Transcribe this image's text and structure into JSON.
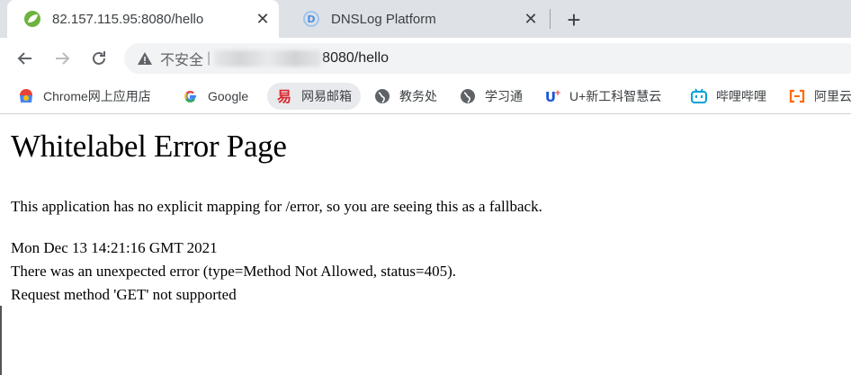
{
  "tabs": [
    {
      "title": "82.157.115.95:8080/hello",
      "icon": "spring-leaf-icon",
      "active": true
    },
    {
      "title": "DNSLog Platform",
      "icon": "dnslog-icon",
      "active": false
    }
  ],
  "address_bar": {
    "security_label": "不安全",
    "separator": "|",
    "url_suffix": "8080/hello"
  },
  "bookmarks": [
    {
      "label": "Chrome网上应用店",
      "icon": "chrome-webstore-icon"
    },
    {
      "label": "Google",
      "icon": "google-icon"
    },
    {
      "label": "网易邮箱",
      "icon": "netease-mail-icon"
    },
    {
      "label": "教务处",
      "icon": "globe-icon"
    },
    {
      "label": "学习通",
      "icon": "globe-icon"
    },
    {
      "label": "U+新工科智慧云",
      "icon": "u-plus-icon"
    },
    {
      "label": "哔哩哔哩",
      "icon": "bilibili-icon"
    },
    {
      "label": "阿里云",
      "icon": "aliyun-icon"
    }
  ],
  "page": {
    "heading": "Whitelabel Error Page",
    "line1": "This application has no explicit mapping for /error, so you are seeing this as a fallback.",
    "timestamp": "Mon Dec 13 14:21:16 GMT 2021",
    "error_line": "There was an unexpected error (type=Method Not Allowed, status=405).",
    "detail_line": "Request method 'GET' not supported"
  },
  "colors": {
    "tabstrip_bg": "#dee1e6",
    "omnibox_bg": "#f1f3f4",
    "spring_green": "#6db33f",
    "dnslog_blue": "#4a90e2",
    "netease_red": "#d9262c",
    "bilibili_blue": "#00a1d6",
    "aliyun_orange": "#ff6a00"
  }
}
